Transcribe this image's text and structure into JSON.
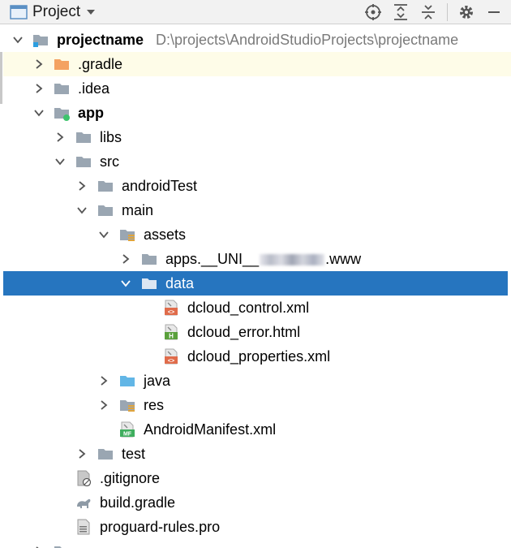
{
  "panel": {
    "title": "Project"
  },
  "tree": {
    "root_name": "projectname",
    "root_path": "D:\\projects\\AndroidStudioProjects\\projectname",
    "items": {
      "gradle": ".gradle",
      "idea": ".idea",
      "app": "app",
      "libs": "libs",
      "src": "src",
      "androidTest": "androidTest",
      "main": "main",
      "assets": "assets",
      "apps_prefix": "apps.__UNI__",
      "apps_suffix": ".www",
      "data": "data",
      "control": "dcloud_control.xml",
      "error": "dcloud_error.html",
      "properties": "dcloud_properties.xml",
      "java": "java",
      "res": "res",
      "manifest": "AndroidManifest.xml",
      "test": "test",
      "gitignore": ".gitignore",
      "build_gradle": "build.gradle",
      "proguard": "proguard-rules.pro"
    }
  },
  "colors": {
    "selection": "#2675bf",
    "folder": "#9aa6b2",
    "gradle_folder": "#f4a261",
    "java_folder": "#62b6e6",
    "xml_badge": "#e06c4b",
    "html_badge": "#5aa03c"
  }
}
